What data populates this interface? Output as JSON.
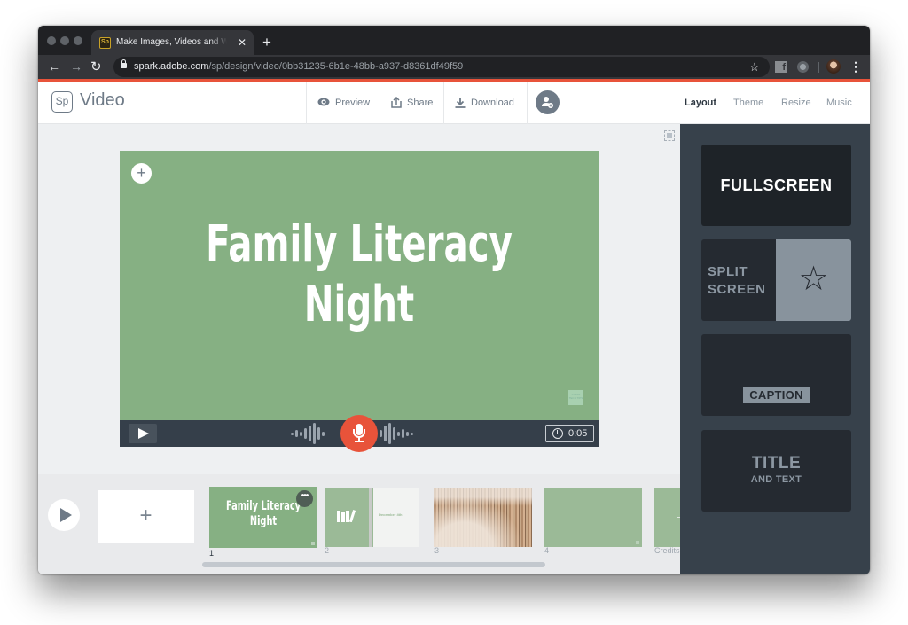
{
  "browser": {
    "tab": {
      "title": "Make Images, Videos and Web Stories",
      "favicon": "Sp"
    },
    "new_tab": "+",
    "close": "✕",
    "url": {
      "domain": "spark.adobe.com",
      "path": "/sp/design/video/0bb31235-6b1e-48bb-a937-d8361df49f59"
    },
    "nav": {
      "back": "←",
      "forward": "→",
      "reload": "↻"
    },
    "bookmark_icon": "☆",
    "extension_fb": "f",
    "menu": "⋮"
  },
  "app": {
    "logo": "Sp",
    "title": "Video",
    "buttons": {
      "preview": "Preview",
      "share": "Share",
      "download": "Download"
    },
    "tabs": [
      {
        "label": "Layout",
        "active": true
      },
      {
        "label": "Theme",
        "active": false
      },
      {
        "label": "Resize",
        "active": false
      },
      {
        "label": "Music",
        "active": false
      }
    ],
    "accent_color": "#e8533a"
  },
  "slide": {
    "title_line1": "Family Literacy",
    "title_line2": "Night",
    "add_symbol": "+",
    "watermark": "CLASS TECH TIPS",
    "background": "#86b083",
    "duration": "0:05"
  },
  "timeline": {
    "add_symbol": "+",
    "more_symbol": "•••",
    "slides": [
      {
        "number": "1",
        "label": "Family Literacy Night",
        "active": true
      },
      {
        "number": "2",
        "label": "December 4th"
      },
      {
        "number": "3",
        "label": ""
      },
      {
        "number": "4",
        "label": ""
      },
      {
        "number": "Credits",
        "label": ""
      }
    ]
  },
  "layouts": {
    "fullscreen": "FULLSCREEN",
    "split_line1": "SPLIT",
    "split_line2": "SCREEN",
    "split_icon": "☆",
    "caption": "CAPTION",
    "title_big": "TITLE",
    "title_small": "AND TEXT"
  }
}
